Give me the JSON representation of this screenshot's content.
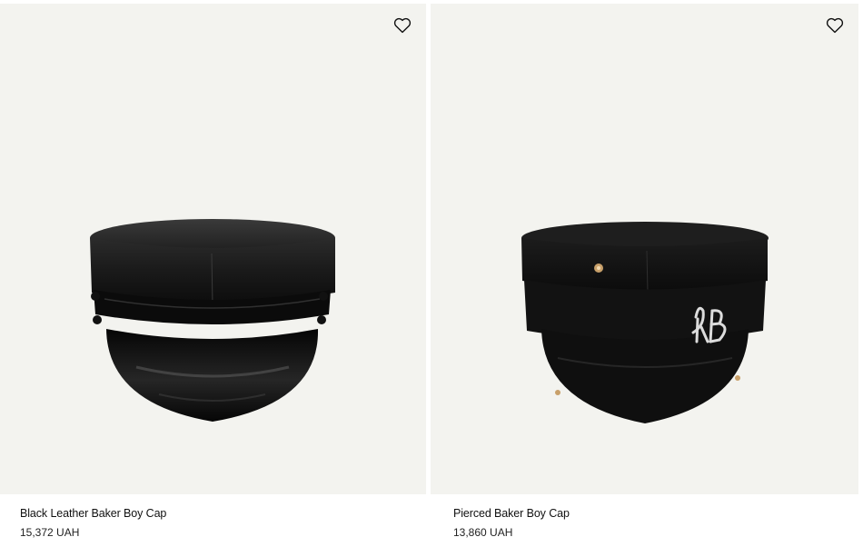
{
  "products": [
    {
      "name": "Black Leather Baker Boy Cap",
      "price": "15,372 UAH",
      "wishlist_icon": "heart-outline-icon",
      "image": "black-leather-cap"
    },
    {
      "name": "Pierced Baker Boy Cap",
      "price": "13,860 UAH",
      "wishlist_icon": "heart-outline-icon",
      "image": "black-wool-cap-rb"
    }
  ],
  "colors": {
    "image_background": "#f3f3ef",
    "text": "#111111"
  }
}
